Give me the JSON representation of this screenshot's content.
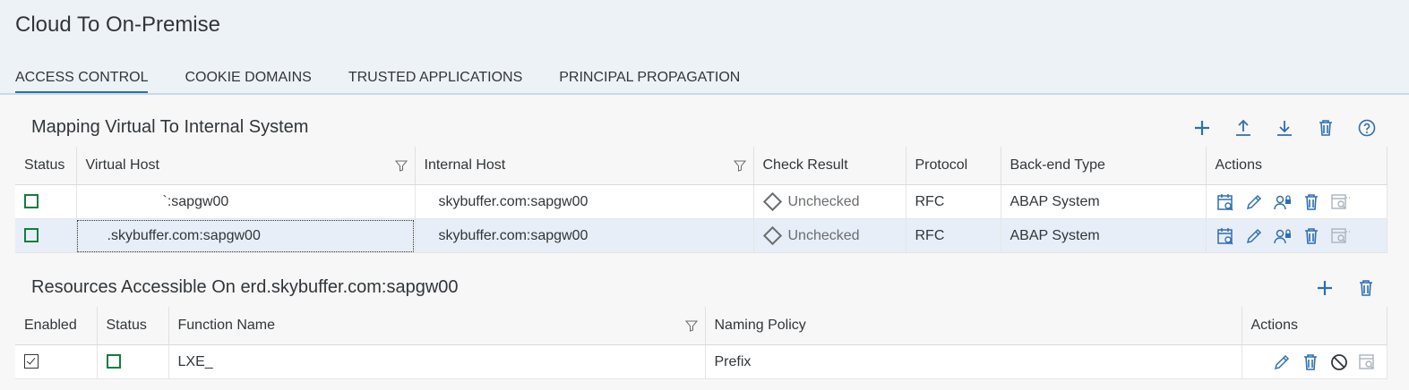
{
  "page": {
    "title": "Cloud To On-Premise"
  },
  "tabs": [
    {
      "label": "ACCESS CONTROL",
      "active": true
    },
    {
      "label": "COOKIE DOMAINS",
      "active": false
    },
    {
      "label": "TRUSTED APPLICATIONS",
      "active": false
    },
    {
      "label": "PRINCIPAL PROPAGATION",
      "active": false
    }
  ],
  "mapping": {
    "title": "Mapping Virtual To Internal System",
    "toolbar_icons": [
      "add-icon",
      "upload-icon",
      "download-icon",
      "delete-icon",
      "help-icon"
    ],
    "columns": [
      "Status",
      "Virtual Host",
      "Internal Host",
      "Check Result",
      "Protocol",
      "Back-end Type",
      "Actions"
    ],
    "rows": [
      {
        "virtual_host": "`:sapgw00",
        "internal_host": "skybuffer.com:sapgw00",
        "check_result": "Unchecked",
        "protocol": "RFC",
        "backend_type": "ABAP System"
      },
      {
        "virtual_host": ".skybuffer.com:sapgw00",
        "internal_host": "skybuffer.com:sapgw00",
        "check_result": "Unchecked",
        "protocol": "RFC",
        "backend_type": "ABAP System"
      }
    ],
    "row_action_icons": [
      "check-availability-icon",
      "edit-icon",
      "principal-type-icon",
      "delete-icon",
      "maintain-resources-icon"
    ]
  },
  "resources": {
    "title": "Resources Accessible On erd.skybuffer.com:sapgw00",
    "toolbar_icons": [
      "add-icon",
      "delete-icon"
    ],
    "columns": [
      "Enabled",
      "Status",
      "Function Name",
      "Naming Policy",
      "Actions"
    ],
    "rows": [
      {
        "function_name": "LXE_",
        "naming_policy": "Prefix"
      }
    ],
    "row_action_icons": [
      "edit-icon",
      "delete-icon",
      "disable-icon",
      "inspect-icon"
    ]
  },
  "colors": {
    "accent": "#2e6fb2",
    "icon": "#2e6fb2",
    "status_ok": "#107e3e",
    "header_bg": "#edf2f7",
    "selected_row": "#e8eef7"
  }
}
